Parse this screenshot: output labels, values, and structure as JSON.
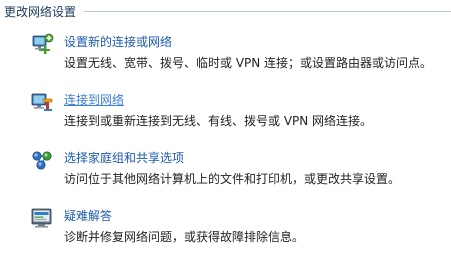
{
  "section": {
    "title": "更改网络设置"
  },
  "tasks": [
    {
      "link": "设置新的连接或网络",
      "description": "设置无线、宽带、拨号、临时或 VPN 连接；或设置路由器或访问点。",
      "icon": "new-connection-icon"
    },
    {
      "link": "连接到网络",
      "description": "连接到或重新连接到无线、有线、拨号或 VPN 网络连接。",
      "icon": "connect-network-icon"
    },
    {
      "link": "选择家庭组和共享选项",
      "description": "访问位于其他网络计算机上的文件和打印机，或更改共享设置。",
      "icon": "homegroup-icon"
    },
    {
      "link": "疑难解答",
      "description": "诊断并修复网络问题，或获得故障排除信息。",
      "icon": "troubleshoot-icon"
    }
  ],
  "colors": {
    "link": "#1c5ab0",
    "link_hover": "#3a7fd8",
    "header_text": "#1e395b",
    "body_text": "#222222"
  }
}
